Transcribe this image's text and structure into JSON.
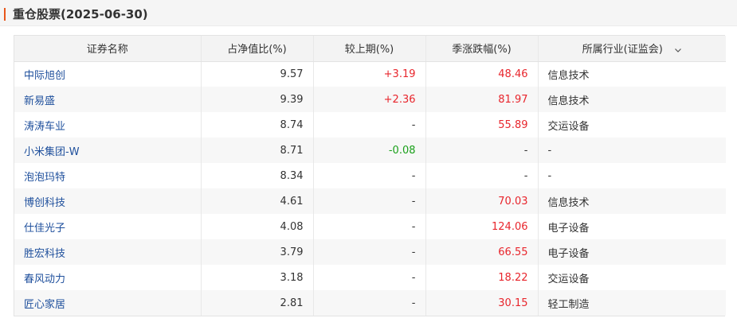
{
  "section": {
    "title": "重仓股票(2025-06-30)",
    "accent_color": "#e8571c"
  },
  "table": {
    "columns": [
      {
        "label": "证券名称"
      },
      {
        "label": "占净值比(%)"
      },
      {
        "label": "较上期(%)"
      },
      {
        "label": "季涨跌幅(%)"
      },
      {
        "label": "所属行业(证监会)",
        "icon": "chevron-down-icon"
      }
    ],
    "rows": [
      {
        "name": "中际旭创",
        "pct": "9.57",
        "change": "+3.19",
        "change_trend": "up",
        "season": "48.46",
        "season_trend": "up",
        "industry": "信息技术"
      },
      {
        "name": "新易盛",
        "pct": "9.39",
        "change": "+2.36",
        "change_trend": "up",
        "season": "81.97",
        "season_trend": "up",
        "industry": "信息技术"
      },
      {
        "name": "涛涛车业",
        "pct": "8.74",
        "change": "-",
        "change_trend": "neutral",
        "season": "55.89",
        "season_trend": "up",
        "industry": "交运设备"
      },
      {
        "name": "小米集团-W",
        "pct": "8.71",
        "change": "-0.08",
        "change_trend": "down",
        "season": "-",
        "season_trend": "neutral",
        "industry": "-"
      },
      {
        "name": "泡泡玛特",
        "pct": "8.34",
        "change": "-",
        "change_trend": "neutral",
        "season": "-",
        "season_trend": "neutral",
        "industry": "-"
      },
      {
        "name": "博创科技",
        "pct": "4.61",
        "change": "-",
        "change_trend": "neutral",
        "season": "70.03",
        "season_trend": "up",
        "industry": "信息技术"
      },
      {
        "name": "仕佳光子",
        "pct": "4.08",
        "change": "-",
        "change_trend": "neutral",
        "season": "124.06",
        "season_trend": "up",
        "industry": "电子设备"
      },
      {
        "name": "胜宏科技",
        "pct": "3.79",
        "change": "-",
        "change_trend": "neutral",
        "season": "66.55",
        "season_trend": "up",
        "industry": "电子设备"
      },
      {
        "name": "春风动力",
        "pct": "3.18",
        "change": "-",
        "change_trend": "neutral",
        "season": "18.22",
        "season_trend": "up",
        "industry": "交运设备"
      },
      {
        "name": "匠心家居",
        "pct": "2.81",
        "change": "-",
        "change_trend": "neutral",
        "season": "30.15",
        "season_trend": "up",
        "industry": "轻工制造"
      }
    ]
  },
  "colors": {
    "link": "#1e4f9c",
    "up": "#e8252c",
    "down": "#1aa01a",
    "header_bg": "#f3f3f3",
    "stripe_bg": "#f7f7f7"
  }
}
